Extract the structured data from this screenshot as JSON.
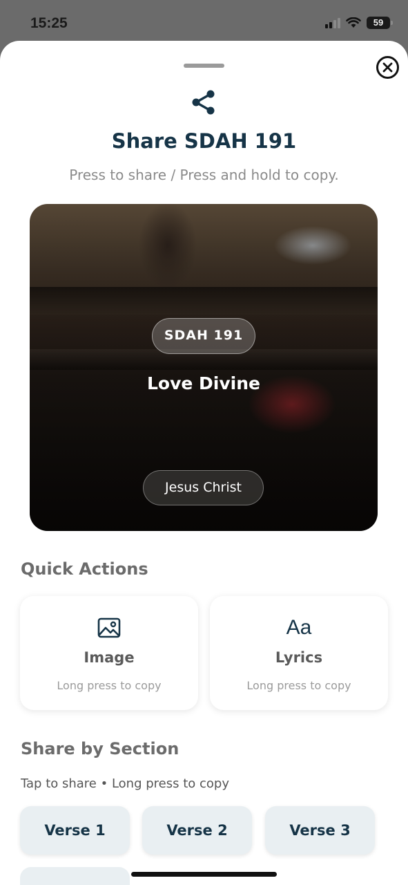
{
  "status_bar": {
    "time": "15:25",
    "battery": "59"
  },
  "sheet": {
    "title": "Share SDAH 191",
    "subtitle": "Press to share / Press and hold to copy.",
    "close_icon": "close-circle-icon",
    "share_icon": "share-icon"
  },
  "hymn_card": {
    "number": "SDAH 191",
    "title": "Love Divine",
    "tag": "Jesus Christ"
  },
  "quick_actions": {
    "heading": "Quick Actions",
    "items": [
      {
        "icon": "image-icon",
        "label": "Image",
        "hint": "Long press to copy"
      },
      {
        "icon": "text-aa-icon",
        "glyph": "Aa",
        "label": "Lyrics",
        "hint": "Long press to copy"
      }
    ]
  },
  "share_by_section": {
    "heading": "Share by Section",
    "hint": "Tap to share • Long press to copy",
    "verses": [
      "Verse 1",
      "Verse 2",
      "Verse 3"
    ]
  },
  "colors": {
    "accent": "#163447",
    "muted": "#8a8a8a",
    "button_bg": "#e9eff2"
  }
}
